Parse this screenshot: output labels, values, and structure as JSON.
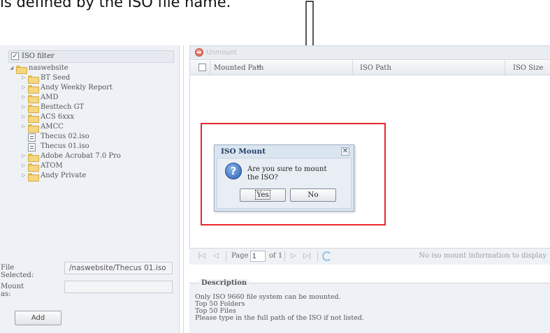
{
  "caption": "is defined by the ISO file name.",
  "filter": {
    "checked": true,
    "label": "ISO filter"
  },
  "tree": {
    "root": "naswebsite",
    "items": [
      {
        "label": "BT Seed",
        "type": "folder"
      },
      {
        "label": "Andy Weekly Report",
        "type": "folder"
      },
      {
        "label": "AMD",
        "type": "folder"
      },
      {
        "label": "Besttech GT",
        "type": "folder"
      },
      {
        "label": "ACS 6xxx",
        "type": "folder"
      },
      {
        "label": "AMCC",
        "type": "folder"
      },
      {
        "label": "Thecus 02.iso",
        "type": "iso"
      },
      {
        "label": "Thecus 01.iso",
        "type": "iso"
      },
      {
        "label": "Adobe Acrobat 7.0 Pro",
        "type": "folder"
      },
      {
        "label": "ATOM",
        "type": "folder"
      },
      {
        "label": "Andy Private",
        "type": "folder"
      }
    ]
  },
  "form": {
    "file_selected_label": "File Selected:",
    "file_selected_value": "/naswebsite/Thecus 01.iso",
    "mount_as_label": "Mount as:",
    "mount_as_value": "",
    "add_label": "Add"
  },
  "grid": {
    "unmount_label": "Unmount",
    "columns": {
      "mounted_path": "Mounted Path",
      "iso_path": "ISO Path",
      "iso_size": "ISO Size"
    }
  },
  "paging": {
    "page_label": "Page",
    "page_value": "1",
    "of_label": "of 1",
    "empty_text": "No iso mount information to display"
  },
  "description": {
    "title": "Description",
    "lines": [
      "Only ISO 9660 file system can be mounted.",
      "Top 50 Folders",
      "Top 50 Files",
      "Please type in the full path of the ISO if not listed."
    ]
  },
  "dialog": {
    "title": "ISO Mount",
    "close_glyph": "✕",
    "icon_glyph": "?",
    "message": "Are you sure to mount the ISO?",
    "yes_label": "Yes",
    "no_label": "No"
  },
  "colors": {
    "highlight": "#e8262d",
    "dialog_title": "#1f3e66"
  }
}
